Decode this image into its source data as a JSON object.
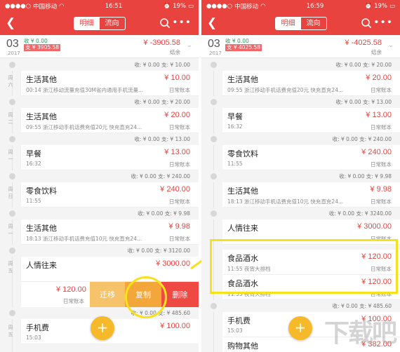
{
  "status_left": {
    "carrier": "中国移动",
    "signal_icon": "signal-icon",
    "wifi_icon": "wifi-icon",
    "time": "16:51",
    "battery": "19%"
  },
  "status_right": {
    "carrier": "中国移动",
    "time": "16:59",
    "battery": "19%"
  },
  "nav": {
    "tab_detail": "明细",
    "tab_flow": "流向",
    "more": "•••"
  },
  "left": {
    "summary": {
      "day": "03",
      "year": "2017",
      "income": "收 ¥ 0.00",
      "expense": "支 ¥ 3905.58",
      "total": "¥ -3905.58",
      "category": "结余"
    },
    "days": [
      {
        "totals": "收: ¥ 0.00  支: ¥ 10.00",
        "weekday": "周六"
      },
      {
        "totals": "收: ¥ 0.00  支: ¥ 20.00",
        "weekday": "周二"
      },
      {
        "totals": "收: ¥ 0.00  支: ¥ 13.00",
        "weekday": "周一"
      },
      {
        "totals": "收: ¥ 0.00  支: ¥ 240.00",
        "weekday": "周日"
      },
      {
        "totals": "收: ¥ 0.00  支: ¥ 9.98",
        "weekday": "周一"
      },
      {
        "totals": "收: ¥ 0.00  支: ¥ 3120.00",
        "weekday": "周五"
      },
      {
        "totals": "收: ¥ 0.00  支: ¥ 485.60",
        "weekday": "周五"
      }
    ],
    "entries": [
      {
        "title": "生活其他",
        "sub": "00:14 浙江移动流量充值30M省内通用手机流量...",
        "amount": "¥ 10.00",
        "account": "日常账本"
      },
      {
        "title": "生活其他",
        "sub": "09:55 浙江移动手机话费充值20元 快充直充24...",
        "amount": "¥ 20.00",
        "account": "日常账本"
      },
      {
        "title": "早餐",
        "sub": "16:32",
        "amount": "¥ 13.00",
        "account": "日常账本"
      },
      {
        "title": "零食饮料",
        "sub": "11:55",
        "amount": "¥ 240.00",
        "account": "日常账本"
      },
      {
        "title": "生活其他",
        "sub": "18:13 浙江移动手机话费充值10元 快充直充24...",
        "amount": "¥ 9.98",
        "account": "日常账本"
      },
      {
        "title": "人情往来",
        "sub": "",
        "amount": "¥ 3000.00",
        "account": ""
      },
      {
        "title": "手机费",
        "sub": "15:03",
        "amount": "¥ 100.00",
        "account": ""
      }
    ],
    "swipe": {
      "amount": "¥ 120.00",
      "account": "日常账本",
      "move": "迁移",
      "copy": "复制",
      "delete": "删除"
    }
  },
  "right": {
    "summary": {
      "day": "03",
      "year": "2017",
      "income": "收 ¥ 0.00",
      "expense": "支 ¥ 4025.58",
      "total": "¥ -4025.58",
      "category": "结余"
    },
    "days": [
      {
        "totals": "收: ¥ 0.00  支: ¥ 10.00"
      },
      {
        "totals": "收: ¥ 0.00  支: ¥ 20.00"
      },
      {
        "totals": "收: ¥ 0.00  支: ¥ 13.00"
      },
      {
        "totals": "收: ¥ 0.00  支: ¥ 240.00"
      },
      {
        "totals": "收: ¥ 0.00  支: ¥ 9.98"
      },
      {
        "totals": "收: ¥ 0.00  支: ¥ 3240.00"
      },
      {
        "totals": "收: ¥ 0.00  支: ¥ 485.60"
      }
    ],
    "entries": [
      {
        "title": "生活其他",
        "sub": "09:55 浙江移动手机话费充值20元 快充直充24...",
        "amount": "¥ 20.00",
        "account": "日常账本"
      },
      {
        "title": "早餐",
        "sub": "16:32",
        "amount": "¥ 13.00",
        "account": "日常账本"
      },
      {
        "title": "零食饮料",
        "sub": "11:55",
        "amount": "¥ 240.00",
        "account": "日常账本"
      },
      {
        "title": "生活其他",
        "sub": "18:13 浙江移动手机话费充值10元 快充直充24...",
        "amount": "¥ 9.98",
        "account": "日常账本"
      },
      {
        "title": "人情往来",
        "sub": "",
        "amount": "¥ 3000.00",
        "account": "日常账本"
      },
      {
        "title": "食品酒水",
        "sub": "11:55 夜宵大排档",
        "amount": "¥ 120.00",
        "account": "日常账本"
      },
      {
        "title": "食品酒水",
        "sub": "11:55 夜宵大排档",
        "amount": "¥ 120.00",
        "account": "日常账本"
      },
      {
        "title": "手机费",
        "sub": "15:03",
        "amount": "¥ 100.00",
        "account": ""
      },
      {
        "title": "购物其他",
        "sub": "",
        "amount": "¥ 382.00",
        "account": ""
      }
    ]
  },
  "fab": "+",
  "colors": {
    "accent": "#e8433e",
    "highlight": "#f7e11c",
    "fab": "#f6b92a"
  }
}
